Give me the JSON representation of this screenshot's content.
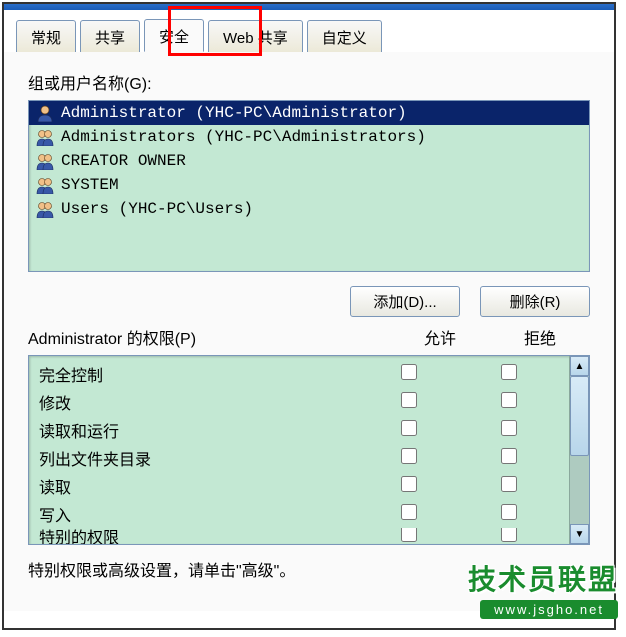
{
  "tabs": [
    {
      "label": "常规",
      "active": false
    },
    {
      "label": "共享",
      "active": false
    },
    {
      "label": "安全",
      "active": true
    },
    {
      "label": "Web 共享",
      "active": false
    },
    {
      "label": "自定义",
      "active": false
    }
  ],
  "section": {
    "group_label": "组或用户名称(G):",
    "users": [
      {
        "name": "Administrator (YHC-PC\\Administrator)",
        "selected": true,
        "icind": "single"
      },
      {
        "name": "Administrators (YHC-PC\\Administrators)",
        "selected": false,
        "icind": "group"
      },
      {
        "name": "CREATOR OWNER",
        "selected": false,
        "icind": "group"
      },
      {
        "name": "SYSTEM",
        "selected": false,
        "icind": "group"
      },
      {
        "name": "Users (YHC-PC\\Users)",
        "selected": false,
        "icind": "group"
      }
    ]
  },
  "buttons": {
    "add": "添加(D)...",
    "remove": "删除(R)"
  },
  "permissions": {
    "header_for": "Administrator 的权限(P)",
    "col_allow": "允许",
    "col_deny": "拒绝",
    "rows": [
      {
        "name": "完全控制"
      },
      {
        "name": "修改"
      },
      {
        "name": "读取和运行"
      },
      {
        "name": "列出文件夹目录"
      },
      {
        "name": "读取"
      },
      {
        "name": "写入"
      },
      {
        "name": "特别的权限"
      }
    ]
  },
  "footer_text": "特别权限或高级设置，请单击\"高级\"。",
  "watermark": {
    "title": "技术员联盟",
    "url": "www.jsgho.net"
  }
}
